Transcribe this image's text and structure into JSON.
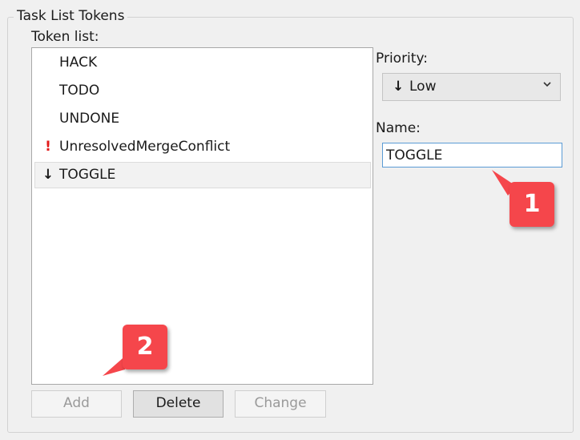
{
  "group": {
    "title": "Task List Tokens"
  },
  "token_list": {
    "label": "Token list:",
    "items": [
      {
        "icon": "",
        "label": "HACK"
      },
      {
        "icon": "",
        "label": "TODO"
      },
      {
        "icon": "",
        "label": "UNDONE"
      },
      {
        "icon": "!",
        "label": "UnresolvedMergeConflict"
      },
      {
        "icon": "↓",
        "label": "TOGGLE",
        "selected": true
      }
    ]
  },
  "priority": {
    "label": "Priority:",
    "arrow": "↓",
    "value": "Low"
  },
  "name": {
    "label": "Name:",
    "value": "TOGGLE"
  },
  "buttons": {
    "add": "Add",
    "delete": "Delete",
    "change": "Change"
  },
  "callouts": [
    "1",
    "2"
  ],
  "colors": {
    "callout": "#f5464b",
    "exclamation": "#e21a1a",
    "focus_border": "#5b9bd5"
  }
}
